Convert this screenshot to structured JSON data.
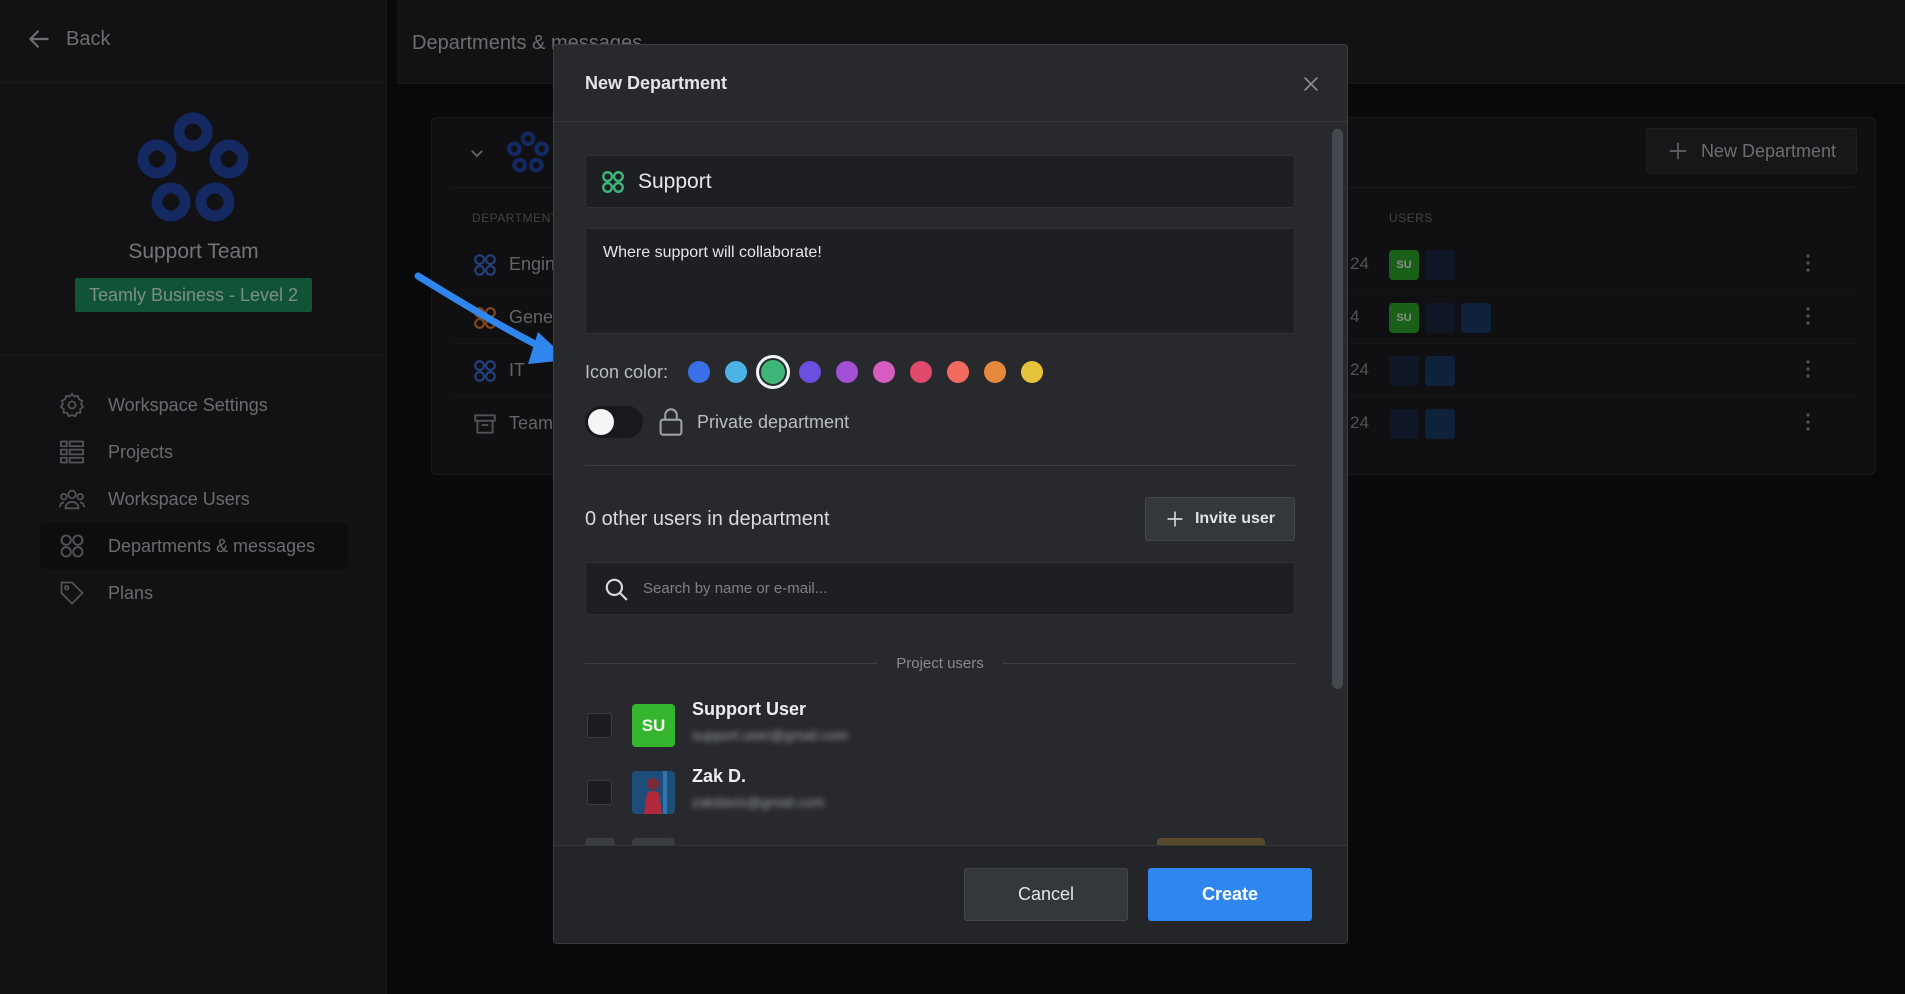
{
  "sidebar": {
    "back_label": "Back",
    "workspace_name": "Support Team",
    "plan_badge": "Teamly Business - Level 2",
    "items": [
      {
        "label": "Workspace Settings",
        "icon": "gear-icon"
      },
      {
        "label": "Projects",
        "icon": "projects-icon"
      },
      {
        "label": "Workspace Users",
        "icon": "users-icon"
      },
      {
        "label": "Departments & messages",
        "icon": "departments-icon",
        "active": true
      },
      {
        "label": "Plans",
        "icon": "tag-icon"
      }
    ]
  },
  "main": {
    "title": "Departments & messages",
    "new_department_label": "New Department",
    "columns": {
      "department": "DEPARTMENT",
      "users": "USERS"
    },
    "rows": [
      {
        "name": "Engin",
        "date": "24",
        "icon_color": "#3d6fd6"
      },
      {
        "name": "Gene",
        "date": "4",
        "icon_color": "#e07a2e"
      },
      {
        "name": "IT",
        "date": "24",
        "icon_color": "#3d6fd6"
      },
      {
        "name": "Team",
        "date": "24",
        "icon_color": "#8a8e96"
      }
    ]
  },
  "modal": {
    "title": "New Department",
    "name_value": "Support",
    "description_value": "Where support will collaborate!",
    "icon_color_label": "Icon color:",
    "colors": [
      "#3b6fe8",
      "#4bb3e6",
      "#3fb57a",
      "#6a4fe0",
      "#a34fd6",
      "#d65cbf",
      "#e04a6a",
      "#f06b5e",
      "#e58a3c",
      "#e5c23c"
    ],
    "selected_color_index": 2,
    "private_label": "Private department",
    "private_enabled": false,
    "users_count_label": "0 other users in department",
    "invite_label": "Invite user",
    "search_placeholder": "Search by name or e-mail...",
    "group_label": "Project users",
    "users": [
      {
        "name": "Support User",
        "initials": "SU",
        "email": "support.user@gmail.com"
      },
      {
        "name": "Zak D.",
        "initials": "",
        "email": "zakdavis@gmail.com"
      }
    ],
    "cancel_label": "Cancel",
    "create_label": "Create"
  },
  "user_badges": {
    "su": "SU"
  },
  "colors": {
    "accent": "#2f86ee",
    "plan_badge": "#1c8f5e",
    "arrow": "#2f86ee",
    "logo": "#2346a8"
  }
}
